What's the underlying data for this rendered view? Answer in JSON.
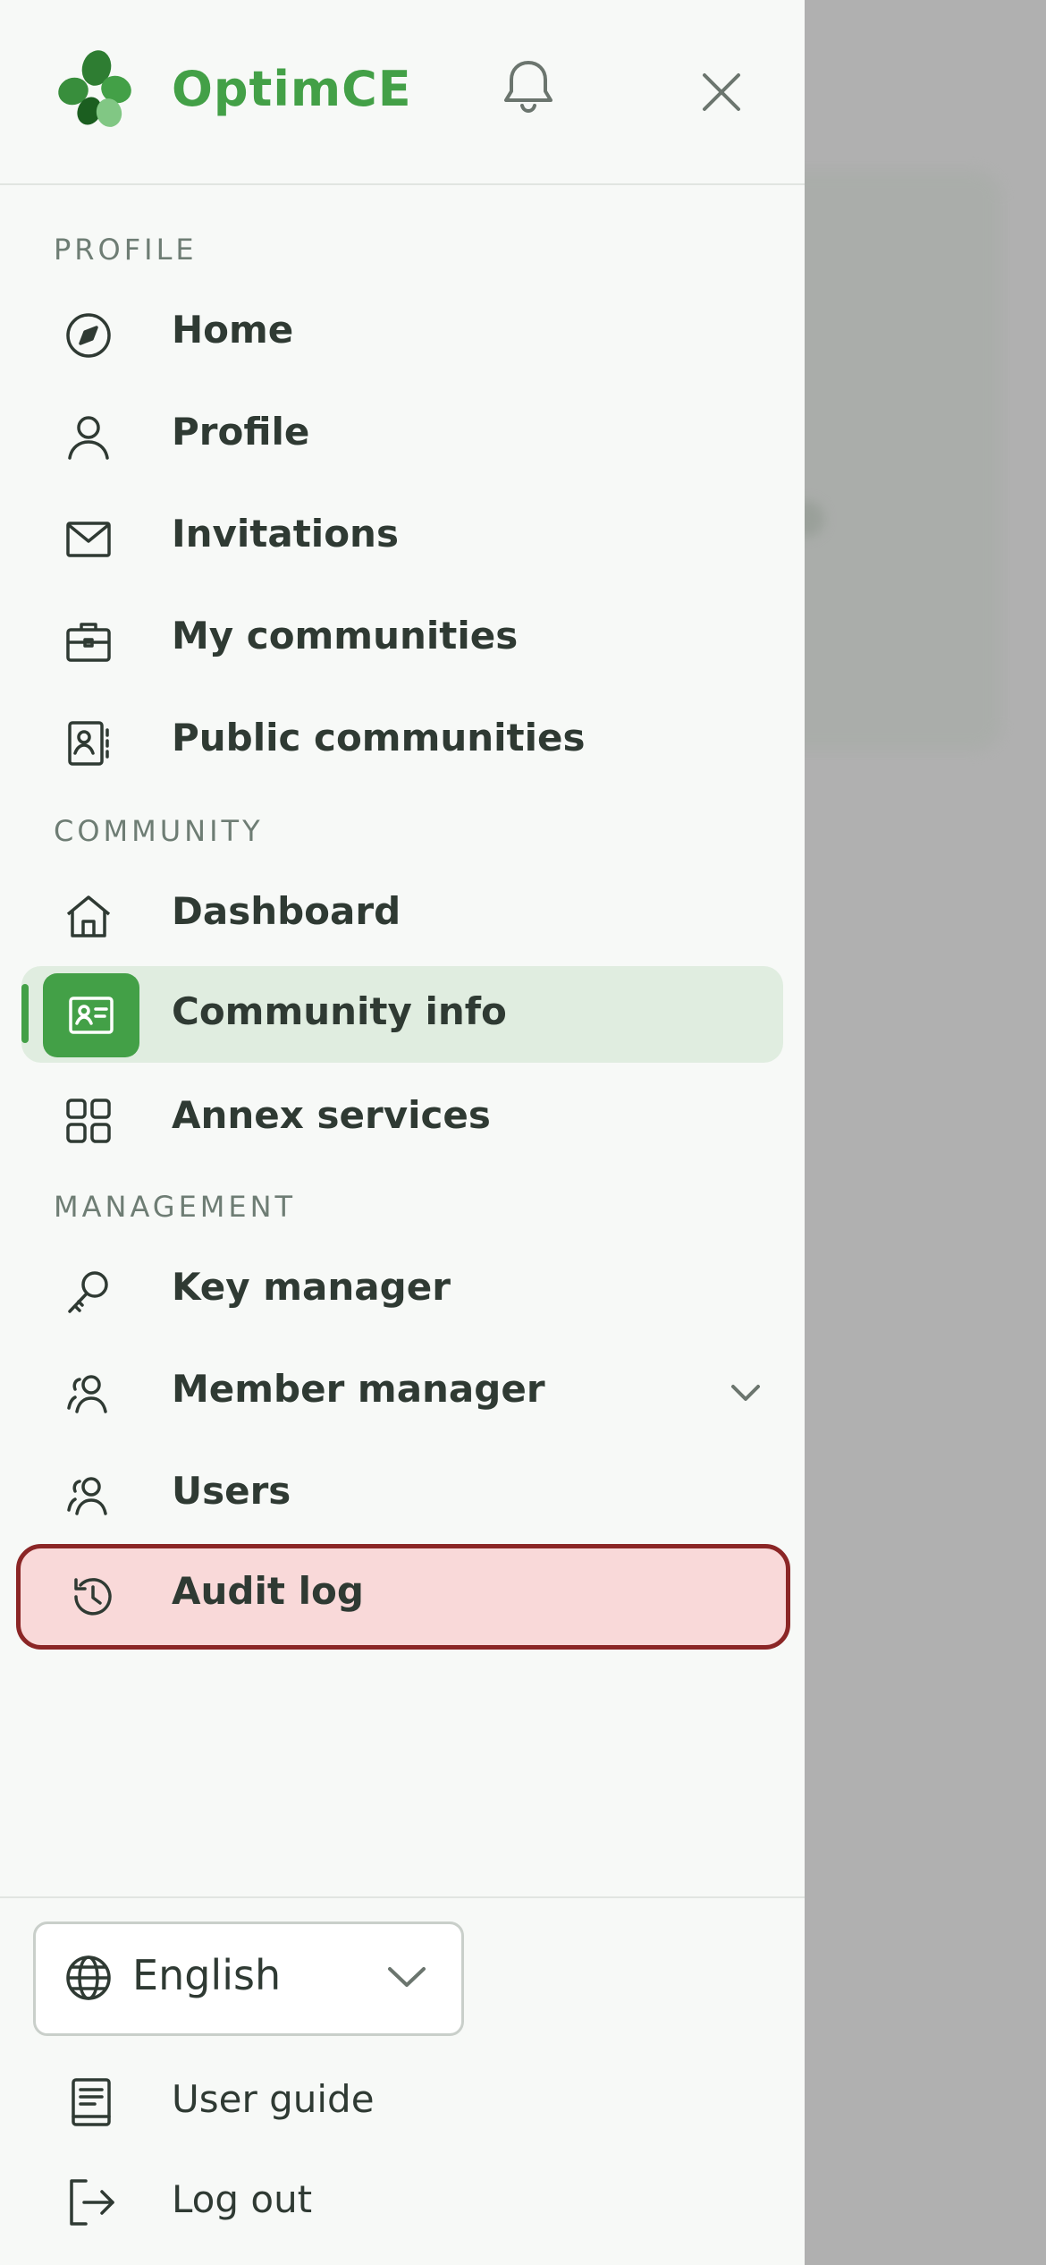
{
  "app": {
    "brand": "OptimCE"
  },
  "colors": {
    "accent": "#43a047",
    "highlight_border": "#8b2626",
    "highlight_fill": "#f9d9d9"
  },
  "sections": {
    "profile": "PROFILE",
    "community": "COMMUNITY",
    "management": "MANAGEMENT"
  },
  "nav": {
    "home": "Home",
    "profile": "Profile",
    "invitations": "Invitations",
    "my_communities": "My communities",
    "public_communities": "Public communities",
    "dashboard": "Dashboard",
    "community_info": "Community info",
    "annex_services": "Annex services",
    "key_manager": "Key manager",
    "member_manager": "Member manager",
    "users": "Users",
    "audit_log": "Audit log"
  },
  "footer": {
    "language": "English",
    "user_guide": "User guide",
    "log_out": "Log out"
  }
}
